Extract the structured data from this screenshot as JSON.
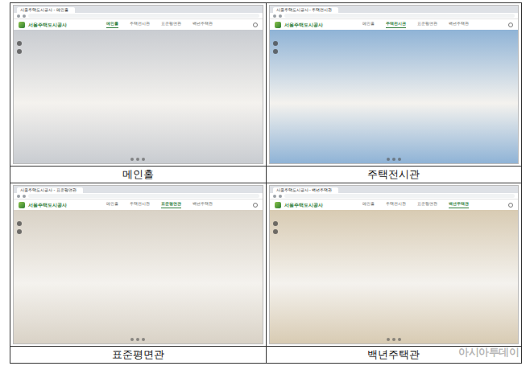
{
  "site": {
    "logo": "서울주택도시공사"
  },
  "panels": [
    {
      "tab_title": "서울주택도시공사 - 메인홀",
      "caption": "메인홀",
      "color": "#c9ccd1",
      "nav": [
        {
          "label": "메인홀",
          "selected": true
        },
        {
          "label": "주택전시관",
          "selected": false
        },
        {
          "label": "표준평면관",
          "selected": false
        },
        {
          "label": "백년주택관",
          "selected": false
        }
      ]
    },
    {
      "tab_title": "서울주택도시공사 - 주택전시관",
      "caption": "주택전시관",
      "color": "#8fb3d6",
      "nav": [
        {
          "label": "메인홀",
          "selected": false
        },
        {
          "label": "주택전시관",
          "selected": true
        },
        {
          "label": "표준평면관",
          "selected": false
        },
        {
          "label": "백년주택관",
          "selected": false
        }
      ]
    },
    {
      "tab_title": "서울주택도시공사 - 표준평면관",
      "caption": "표준평면관",
      "color": "#d9d2c6",
      "nav": [
        {
          "label": "메인홀",
          "selected": false
        },
        {
          "label": "주택전시관",
          "selected": false
        },
        {
          "label": "표준평면관",
          "selected": true
        },
        {
          "label": "백년주택관",
          "selected": false
        }
      ]
    },
    {
      "tab_title": "서울주택도시공사 - 백년주택관",
      "caption": "백년주택관",
      "color": "#d8cbb3",
      "nav": [
        {
          "label": "메인홀",
          "selected": false
        },
        {
          "label": "주택전시관",
          "selected": false
        },
        {
          "label": "표준평면관",
          "selected": false
        },
        {
          "label": "백년주택관",
          "selected": true
        }
      ]
    }
  ],
  "watermark": "아시아투데이"
}
